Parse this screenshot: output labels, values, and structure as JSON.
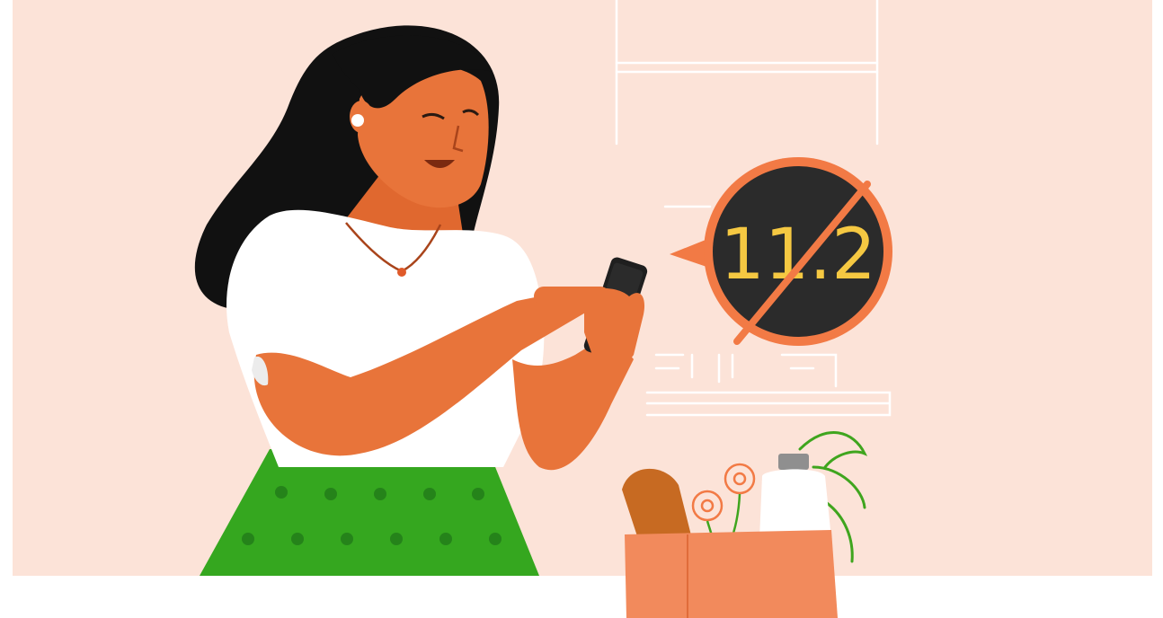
{
  "illustration": {
    "reading_value": "11.2",
    "colors": {
      "background_panel": "#fce3d8",
      "skin": "#e8743a",
      "hair": "#111111",
      "top": "#ffffff",
      "skirt": "#35a71f",
      "skirt_dots": "#25831a",
      "phone": "#1f1f1f",
      "bubble_fill": "#2b2b2b",
      "bubble_ring": "#f27a45",
      "reading_text": "#f5c842",
      "bag": "#f28a5c",
      "bread": "#c76a22",
      "milk_jug": "#ffffff",
      "milk_cap": "#8f8f8f",
      "plant": "#3fa51e",
      "flowers": "#f27a45",
      "sensor_patch": "#ececec"
    }
  }
}
